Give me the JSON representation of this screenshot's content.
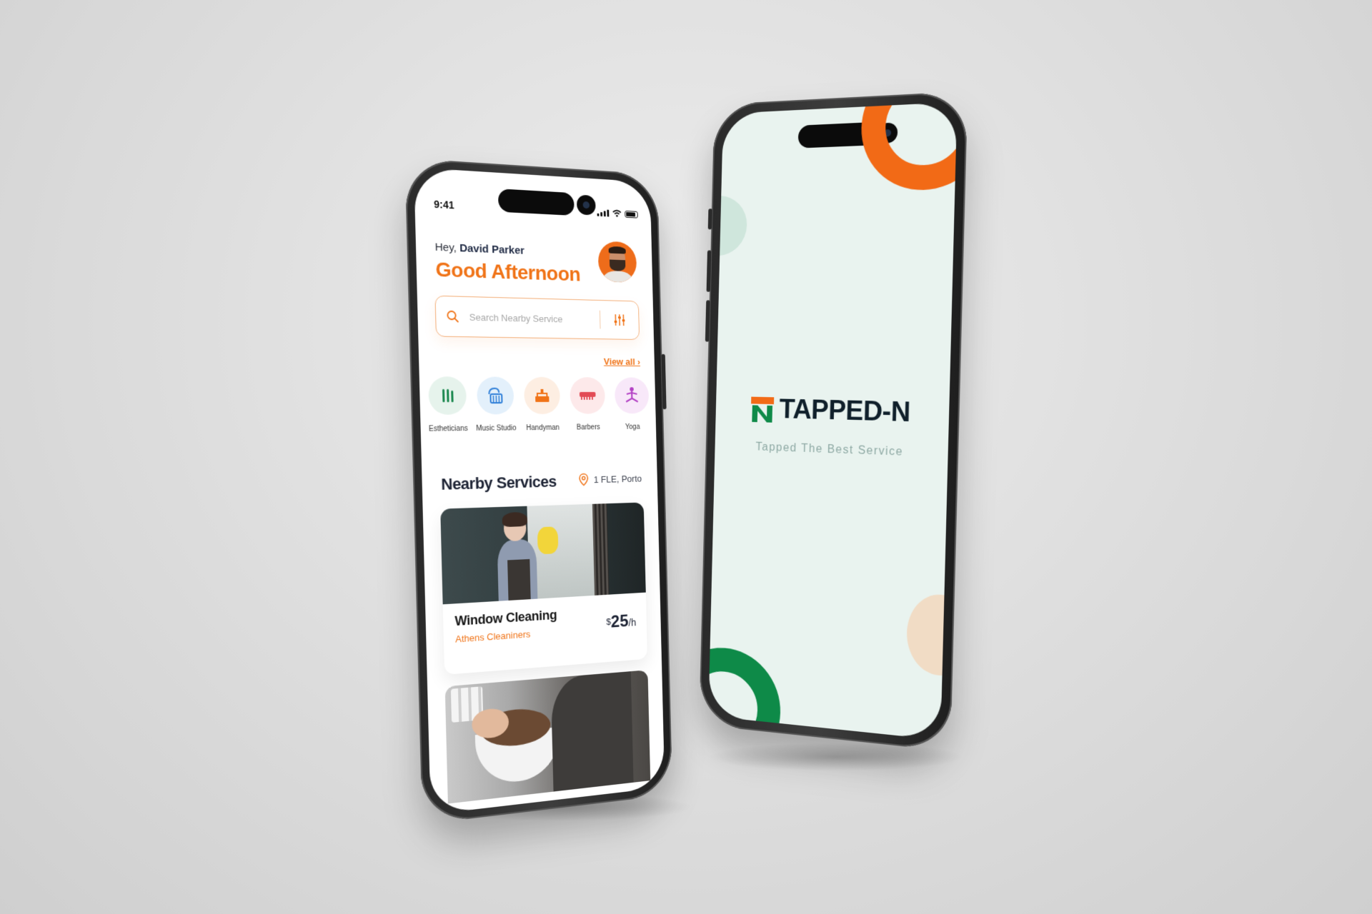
{
  "left_phone": {
    "status": {
      "time": "9:41"
    },
    "greeting": {
      "prefix": "Hey,",
      "name": "David Parker",
      "title": "Good Afternoon"
    },
    "search": {
      "placeholder": "Search Nearby Service",
      "value": ""
    },
    "view_all": "View all",
    "categories": [
      {
        "label": "Estheticians",
        "icon": "brush-icon",
        "bg": "#e6f3ec",
        "color": "#1f8a52"
      },
      {
        "label": "Music Studio",
        "icon": "piano-icon",
        "bg": "#e3f0fb",
        "color": "#2f7fd8"
      },
      {
        "label": "Handyman",
        "icon": "toolbox-icon",
        "bg": "#fdeee2",
        "color": "#f07317"
      },
      {
        "label": "Barbers",
        "icon": "comb-icon",
        "bg": "#fde9ea",
        "color": "#e24b55"
      },
      {
        "label": "Yoga",
        "icon": "yoga-icon",
        "bg": "#f8e8f9",
        "color": "#b23fc4"
      }
    ],
    "nearby": {
      "title": "Nearby Services",
      "location": "1 FLE, Porto"
    },
    "cards": [
      {
        "title": "Window Cleaning",
        "provider": "Athens Cleaniners",
        "currency": "$",
        "price": "25",
        "unit": "/h"
      }
    ]
  },
  "right_phone": {
    "brand_name": "TAPPED-N",
    "tagline": "Tapped The Best Service"
  },
  "colors": {
    "accent_orange": "#f07317",
    "brand_green": "#0e8a48",
    "splash_bg": "#e9f3ef"
  }
}
